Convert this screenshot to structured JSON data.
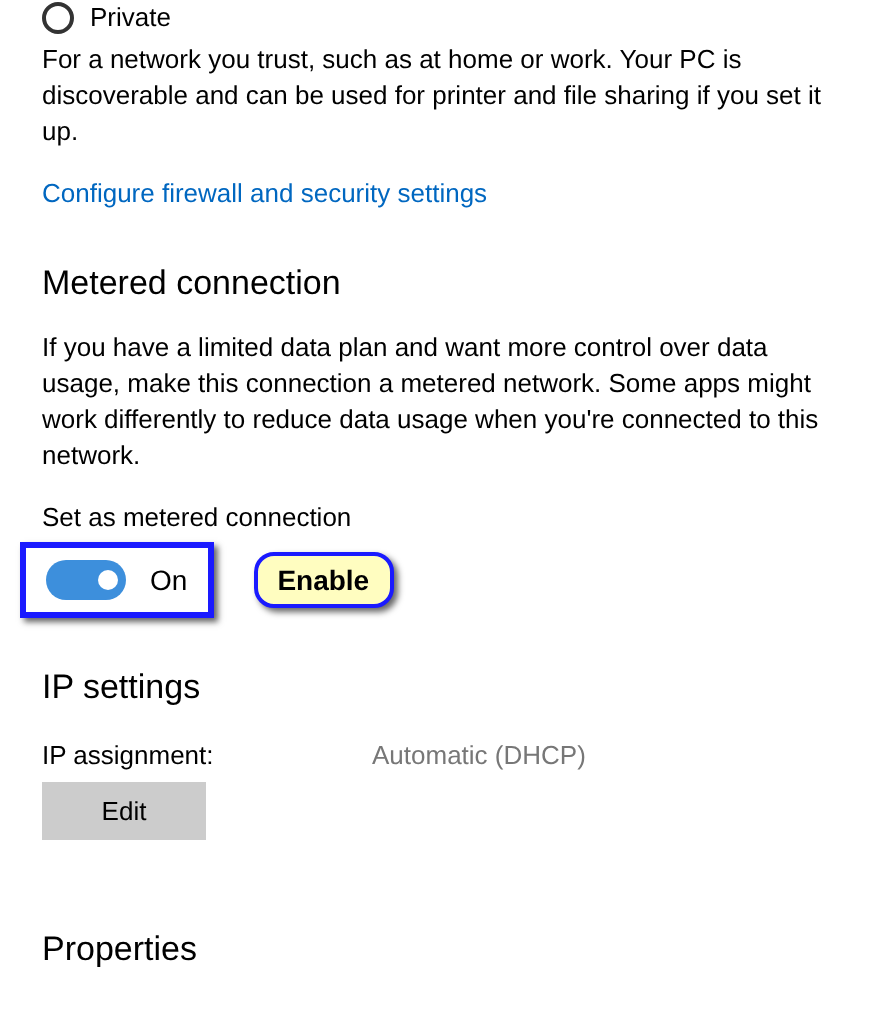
{
  "network_profile": {
    "option": {
      "label": "Private",
      "selected": false
    },
    "description": "For a network you trust, such as at home or work. Your PC is discoverable and can be used for printer and file sharing if you set it up.",
    "link": "Configure firewall and security settings"
  },
  "metered_connection": {
    "heading": "Metered connection",
    "description": "If you have a limited data plan and want more control over data usage, make this connection a metered network. Some apps might work differently to reduce data usage when you're connected to this network.",
    "toggle_label": "Set as metered connection",
    "toggle": {
      "on": true,
      "state_text": "On"
    },
    "callout": "Enable"
  },
  "ip_settings": {
    "heading": "IP settings",
    "label": "IP assignment:",
    "value": "Automatic (DHCP)",
    "button": "Edit"
  },
  "properties": {
    "heading": "Properties"
  }
}
